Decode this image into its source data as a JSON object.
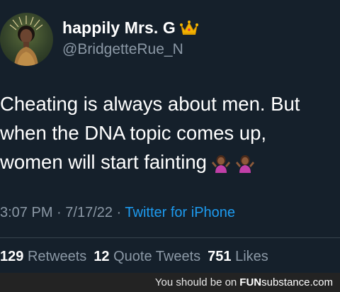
{
  "header": {
    "display_name": "happily Mrs. G",
    "crown_icon": "crown-icon",
    "handle": "@BridgetteRue_N"
  },
  "tweet": {
    "lines": [
      "Cheating is always about men. But",
      "when the DNA topic comes up,",
      "women will start fainting"
    ],
    "emojis": [
      "person-shrugging-emoji",
      "person-shrugging-emoji"
    ]
  },
  "meta": {
    "time": "3:07 PM",
    "sep1": " · ",
    "date": "7/17/22",
    "sep2": " · ",
    "source": "Twitter for iPhone"
  },
  "stats": {
    "retweets_count": "129",
    "retweets_label": "Retweets",
    "quotes_count": "12",
    "quotes_label": "Quote Tweets",
    "likes_count": "751",
    "likes_label": "Likes"
  },
  "footer": {
    "text": "You should be on",
    "brand_a": "FUN",
    "brand_b": "substance.com"
  },
  "colors": {
    "background": "#15202b",
    "secondary_text": "#8b98a5",
    "link": "#1d9bf0",
    "divider": "#38444d",
    "footer_bg": "#232323"
  }
}
